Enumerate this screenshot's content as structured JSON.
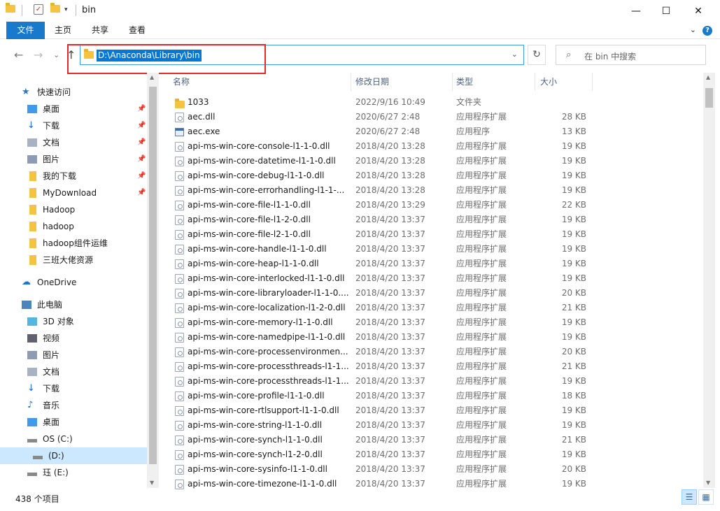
{
  "window": {
    "title": "bin",
    "controls": {
      "minimize": "—",
      "maximize": "☐",
      "close": "✕"
    }
  },
  "ribbon": {
    "tabs": [
      "文件",
      "主页",
      "共享",
      "查看"
    ],
    "help": "?"
  },
  "nav": {
    "back": "←",
    "forward": "→",
    "history": "⌄",
    "up": "↑",
    "address": "D:\\Anaconda\\Library\\bin",
    "refresh": "↻",
    "search_placeholder": "在 bin 中搜索"
  },
  "sidebar": {
    "items": [
      {
        "label": "快速访问",
        "icon": "star-icon",
        "pinned": false
      },
      {
        "label": "桌面",
        "icon": "desktop-icon",
        "pinned": true
      },
      {
        "label": "下载",
        "icon": "download-icon",
        "pinned": true
      },
      {
        "label": "文档",
        "icon": "document-icon",
        "pinned": true
      },
      {
        "label": "图片",
        "icon": "pictures-icon",
        "pinned": true
      },
      {
        "label": "我的下载",
        "icon": "folder-icon",
        "pinned": true
      },
      {
        "label": "MyDownload",
        "icon": "folder-icon",
        "pinned": true
      },
      {
        "label": "Hadoop",
        "icon": "folder-icon",
        "pinned": false
      },
      {
        "label": "hadoop",
        "icon": "folder-icon",
        "pinned": false
      },
      {
        "label": "hadoop组件运维",
        "icon": "folder-icon",
        "pinned": false
      },
      {
        "label": "三班大佬资源",
        "icon": "folder-icon",
        "pinned": false
      },
      {
        "label": "OneDrive",
        "icon": "cloud-icon",
        "pinned": false
      },
      {
        "label": "此电脑",
        "icon": "computer-icon",
        "pinned": false
      },
      {
        "label": "3D 对象",
        "icon": "3d-objects-icon",
        "pinned": false
      },
      {
        "label": "视频",
        "icon": "video-icon",
        "pinned": false
      },
      {
        "label": "图片",
        "icon": "pictures-icon",
        "pinned": false
      },
      {
        "label": "文档",
        "icon": "document-icon",
        "pinned": false
      },
      {
        "label": "下载",
        "icon": "download-icon",
        "pinned": false
      },
      {
        "label": "音乐",
        "icon": "music-icon",
        "pinned": false
      },
      {
        "label": "桌面",
        "icon": "desktop-icon",
        "pinned": false
      },
      {
        "label": "OS (C:)",
        "icon": "drive-icon",
        "pinned": false
      },
      {
        "label": "(D:)",
        "icon": "drive-icon",
        "pinned": false
      },
      {
        "label": "珏 (E:)",
        "icon": "drive-icon",
        "pinned": false
      }
    ],
    "pin_glyph": "📌"
  },
  "columns": {
    "name": "名称",
    "date": "修改日期",
    "type": "类型",
    "size": "大小"
  },
  "files": [
    {
      "name": "1033",
      "date": "2022/9/16 10:49",
      "type": "文件夹",
      "size": "",
      "kind": "folder"
    },
    {
      "name": "aec.dll",
      "date": "2020/6/27 2:48",
      "type": "应用程序扩展",
      "size": "28 KB",
      "kind": "dll"
    },
    {
      "name": "aec.exe",
      "date": "2020/6/27 2:48",
      "type": "应用程序",
      "size": "13 KB",
      "kind": "exe"
    },
    {
      "name": "api-ms-win-core-console-l1-1-0.dll",
      "date": "2018/4/20 13:28",
      "type": "应用程序扩展",
      "size": "19 KB",
      "kind": "dll"
    },
    {
      "name": "api-ms-win-core-datetime-l1-1-0.dll",
      "date": "2018/4/20 13:28",
      "type": "应用程序扩展",
      "size": "19 KB",
      "kind": "dll"
    },
    {
      "name": "api-ms-win-core-debug-l1-1-0.dll",
      "date": "2018/4/20 13:28",
      "type": "应用程序扩展",
      "size": "19 KB",
      "kind": "dll"
    },
    {
      "name": "api-ms-win-core-errorhandling-l1-1-...",
      "date": "2018/4/20 13:28",
      "type": "应用程序扩展",
      "size": "19 KB",
      "kind": "dll"
    },
    {
      "name": "api-ms-win-core-file-l1-1-0.dll",
      "date": "2018/4/20 13:29",
      "type": "应用程序扩展",
      "size": "22 KB",
      "kind": "dll"
    },
    {
      "name": "api-ms-win-core-file-l1-2-0.dll",
      "date": "2018/4/20 13:37",
      "type": "应用程序扩展",
      "size": "19 KB",
      "kind": "dll"
    },
    {
      "name": "api-ms-win-core-file-l2-1-0.dll",
      "date": "2018/4/20 13:37",
      "type": "应用程序扩展",
      "size": "19 KB",
      "kind": "dll"
    },
    {
      "name": "api-ms-win-core-handle-l1-1-0.dll",
      "date": "2018/4/20 13:37",
      "type": "应用程序扩展",
      "size": "19 KB",
      "kind": "dll"
    },
    {
      "name": "api-ms-win-core-heap-l1-1-0.dll",
      "date": "2018/4/20 13:37",
      "type": "应用程序扩展",
      "size": "19 KB",
      "kind": "dll"
    },
    {
      "name": "api-ms-win-core-interlocked-l1-1-0.dll",
      "date": "2018/4/20 13:37",
      "type": "应用程序扩展",
      "size": "19 KB",
      "kind": "dll"
    },
    {
      "name": "api-ms-win-core-libraryloader-l1-1-0....",
      "date": "2018/4/20 13:37",
      "type": "应用程序扩展",
      "size": "20 KB",
      "kind": "dll"
    },
    {
      "name": "api-ms-win-core-localization-l1-2-0.dll",
      "date": "2018/4/20 13:37",
      "type": "应用程序扩展",
      "size": "21 KB",
      "kind": "dll"
    },
    {
      "name": "api-ms-win-core-memory-l1-1-0.dll",
      "date": "2018/4/20 13:37",
      "type": "应用程序扩展",
      "size": "19 KB",
      "kind": "dll"
    },
    {
      "name": "api-ms-win-core-namedpipe-l1-1-0.dll",
      "date": "2018/4/20 13:37",
      "type": "应用程序扩展",
      "size": "19 KB",
      "kind": "dll"
    },
    {
      "name": "api-ms-win-core-processenvironmen...",
      "date": "2018/4/20 13:37",
      "type": "应用程序扩展",
      "size": "20 KB",
      "kind": "dll"
    },
    {
      "name": "api-ms-win-core-processthreads-l1-1...",
      "date": "2018/4/20 13:37",
      "type": "应用程序扩展",
      "size": "21 KB",
      "kind": "dll"
    },
    {
      "name": "api-ms-win-core-processthreads-l1-1...",
      "date": "2018/4/20 13:37",
      "type": "应用程序扩展",
      "size": "19 KB",
      "kind": "dll"
    },
    {
      "name": "api-ms-win-core-profile-l1-1-0.dll",
      "date": "2018/4/20 13:37",
      "type": "应用程序扩展",
      "size": "18 KB",
      "kind": "dll"
    },
    {
      "name": "api-ms-win-core-rtlsupport-l1-1-0.dll",
      "date": "2018/4/20 13:37",
      "type": "应用程序扩展",
      "size": "19 KB",
      "kind": "dll"
    },
    {
      "name": "api-ms-win-core-string-l1-1-0.dll",
      "date": "2018/4/20 13:37",
      "type": "应用程序扩展",
      "size": "19 KB",
      "kind": "dll"
    },
    {
      "name": "api-ms-win-core-synch-l1-1-0.dll",
      "date": "2018/4/20 13:37",
      "type": "应用程序扩展",
      "size": "21 KB",
      "kind": "dll"
    },
    {
      "name": "api-ms-win-core-synch-l1-2-0.dll",
      "date": "2018/4/20 13:37",
      "type": "应用程序扩展",
      "size": "19 KB",
      "kind": "dll"
    },
    {
      "name": "api-ms-win-core-sysinfo-l1-1-0.dll",
      "date": "2018/4/20 13:37",
      "type": "应用程序扩展",
      "size": "20 KB",
      "kind": "dll"
    },
    {
      "name": "api-ms-win-core-timezone-l1-1-0.dll",
      "date": "2018/4/20 13:37",
      "type": "应用程序扩展",
      "size": "19 KB",
      "kind": "dll"
    }
  ],
  "status": {
    "count": "438 个项目"
  },
  "view": {
    "details": "☰",
    "tiles": "▦"
  },
  "colors": {
    "accent": "#1979ca",
    "selection": "#cce8ff",
    "highlight_box": "#e8262c"
  }
}
